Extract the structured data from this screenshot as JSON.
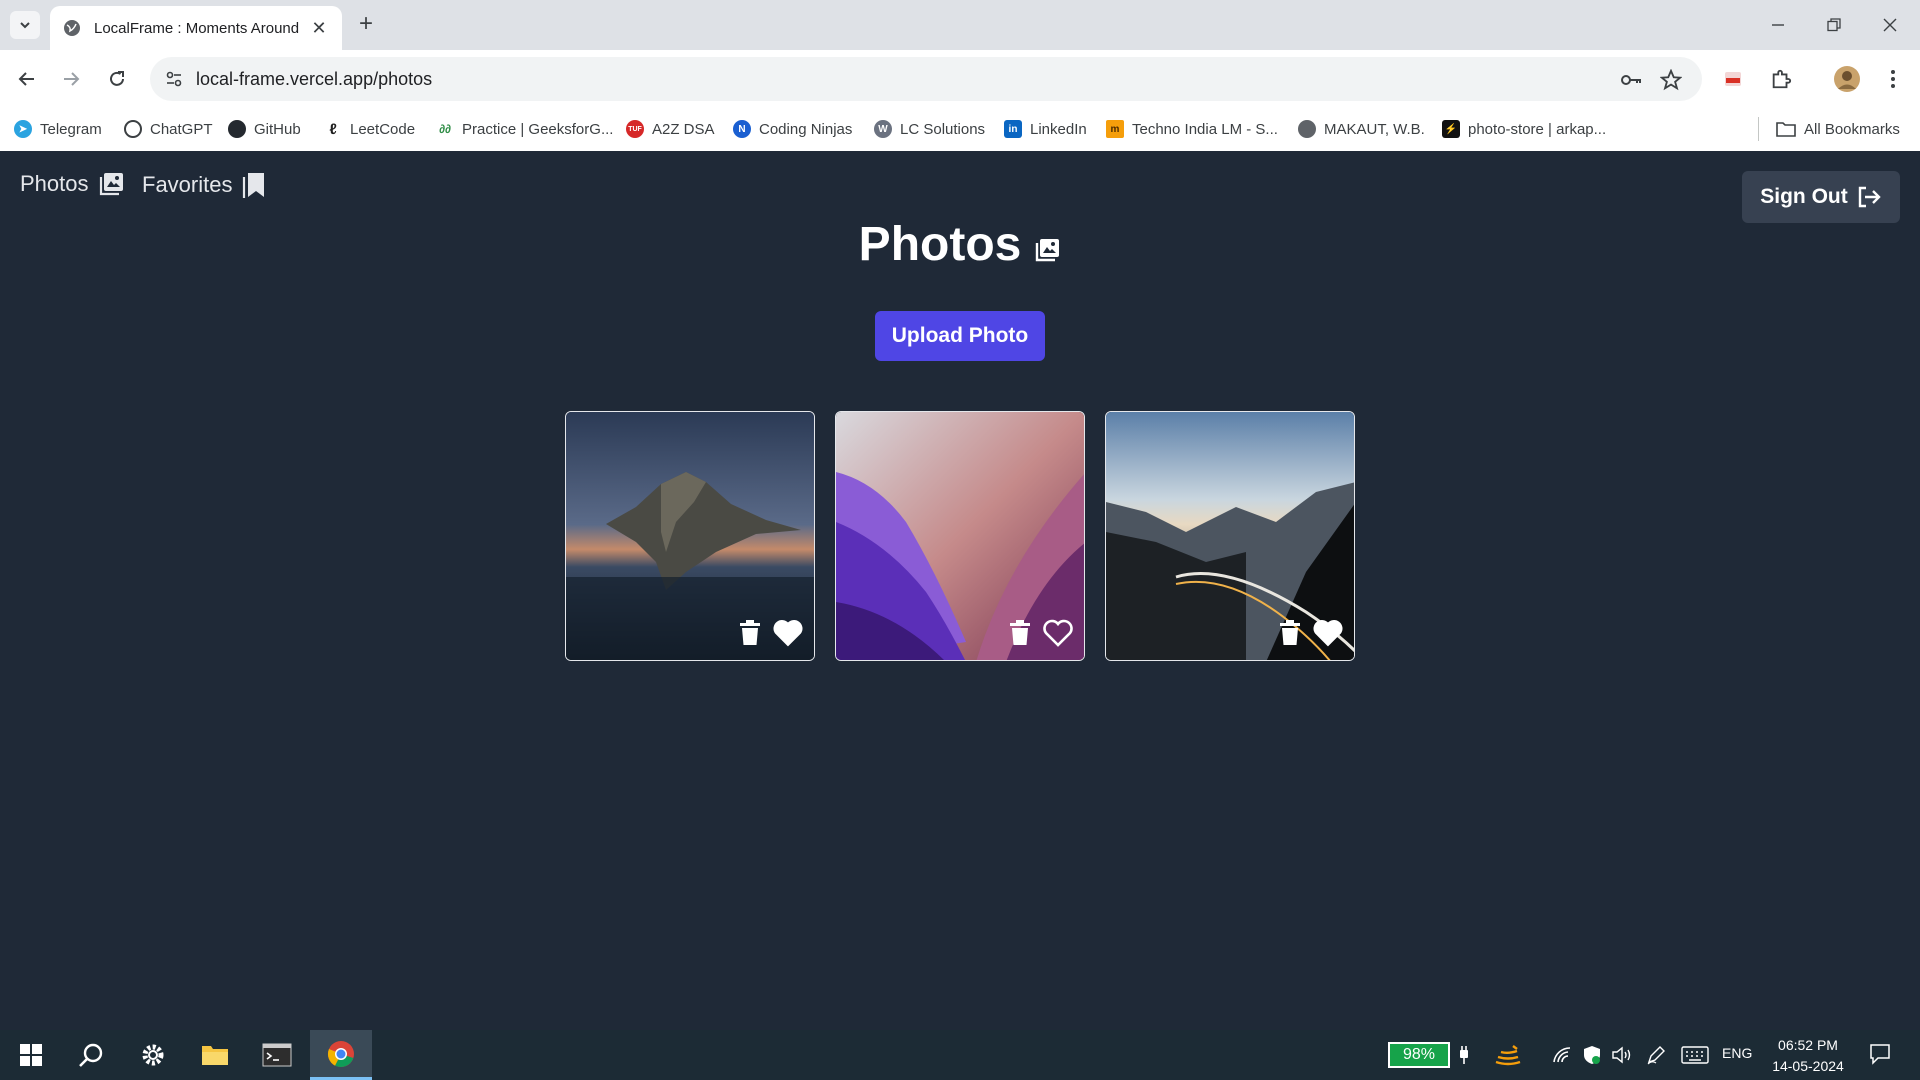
{
  "browser": {
    "tab_title": "LocalFrame : Moments Around",
    "url": "local-frame.vercel.app/photos",
    "bookmarks": [
      {
        "label": "Telegram",
        "icon": "telegram-icon"
      },
      {
        "label": "ChatGPT",
        "icon": "chatgpt-icon"
      },
      {
        "label": "GitHub",
        "icon": "github-icon"
      },
      {
        "label": "LeetCode",
        "icon": "leetcode-icon"
      },
      {
        "label": "Practice | GeeksforG...",
        "icon": "geeksforgeeks-icon"
      },
      {
        "label": "A2Z DSA",
        "icon": "tuf-icon"
      },
      {
        "label": "Coding Ninjas",
        "icon": "coding-ninjas-icon"
      },
      {
        "label": "LC Solutions",
        "icon": "wordpress-icon"
      },
      {
        "label": "LinkedIn",
        "icon": "linkedin-icon"
      },
      {
        "label": "Techno India LM - S...",
        "icon": "techno-india-icon"
      },
      {
        "label": "MAKAUT, W.B.",
        "icon": "globe-icon"
      },
      {
        "label": "photo-store | arkap...",
        "icon": "photo-store-icon"
      }
    ],
    "all_bookmarks": "All Bookmarks"
  },
  "app": {
    "nav_photos": "Photos",
    "nav_favorites": "Favorites",
    "sign_out": "Sign Out",
    "title": "Photos",
    "upload": "Upload Photo",
    "photos": [
      {
        "subject": "island at dusk",
        "favorited": true
      },
      {
        "subject": "purple abstract mountains",
        "favorited": false
      },
      {
        "subject": "mountain road at sunset",
        "favorited": true
      }
    ]
  },
  "taskbar": {
    "battery": "98%",
    "lang": "ENG",
    "time": "06:52 PM",
    "date": "14-05-2024"
  },
  "colors": {
    "page_bg": "#1f2937",
    "accent": "#4f46e5",
    "signout_bg": "#374151"
  }
}
